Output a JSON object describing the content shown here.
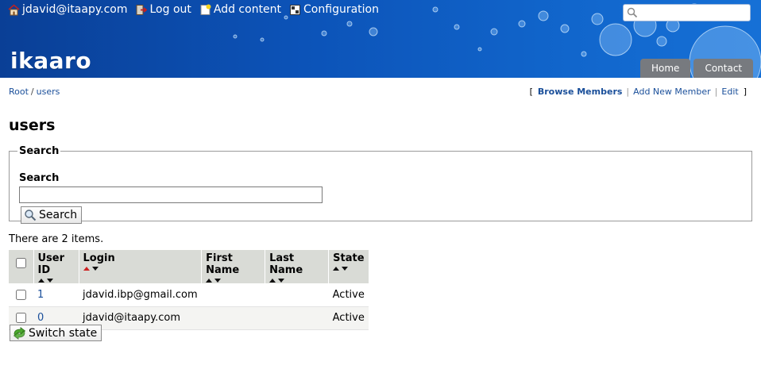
{
  "header": {
    "user_email": "jdavid@itaapy.com",
    "logout_label": "Log out",
    "add_content_label": "Add content",
    "configuration_label": "Configuration",
    "logo_text": "ikaaro",
    "search_value": "",
    "nav_tabs": [
      {
        "label": "Home",
        "icon": "none"
      },
      {
        "label": "Contact",
        "icon": "none"
      }
    ]
  },
  "breadcrumb": {
    "root": "Root",
    "separator": "/",
    "current": "users"
  },
  "actions": {
    "open_bracket": "[",
    "close_bracket": "]",
    "separator": "|",
    "items": [
      {
        "label": "Browse Members",
        "active": true
      },
      {
        "label": "Add New Member",
        "active": false
      },
      {
        "label": "Edit",
        "active": false
      }
    ]
  },
  "page_title": "users",
  "search": {
    "legend": "Search",
    "label": "Search",
    "input_value": "",
    "button_label": "Search"
  },
  "listing": {
    "count_text": "There are 2 items.",
    "columns": [
      "User ID",
      "Login",
      "First Name",
      "Last Name",
      "State"
    ],
    "sorted_column": "Login",
    "rows": [
      {
        "user_id": "1",
        "login": "jdavid.ibp@gmail.com",
        "first_name": "",
        "last_name": "",
        "state": "Active"
      },
      {
        "user_id": "0",
        "login": "jdavid@itaapy.com",
        "first_name": "",
        "last_name": "",
        "state": "Active"
      }
    ],
    "switch_button_label": "Switch state"
  },
  "colors": {
    "header_blue": "#0c53b8",
    "link_blue": "#1a4f9a",
    "tab_gray": "#777a7f",
    "sort_active_red": "#cc2222"
  },
  "icons": {
    "user": "house-icon",
    "logout": "logout-icon",
    "add_content": "new-document-icon",
    "configuration": "configuration-icon",
    "search_button": "magnifier-icon",
    "switch_button": "switch-arrow-icon"
  }
}
